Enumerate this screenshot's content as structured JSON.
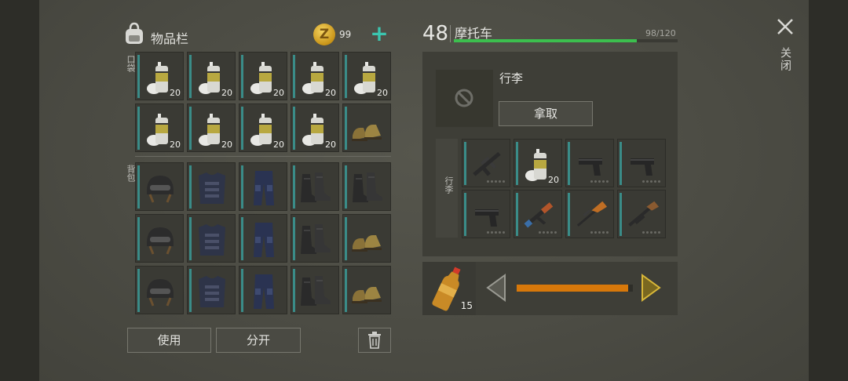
{
  "inventory": {
    "title": "物品栏",
    "coins": "99",
    "pocket_label": "口袋",
    "backpack_label": "背包",
    "pocket_slots": [
      {
        "item": "spray-paint",
        "qty": "20"
      },
      {
        "item": "spray-paint",
        "qty": "20"
      },
      {
        "item": "spray-paint",
        "qty": "20"
      },
      {
        "item": "spray-paint",
        "qty": "20"
      },
      {
        "item": "spray-paint",
        "qty": "20"
      },
      {
        "item": "spray-paint",
        "qty": "20"
      },
      {
        "item": "spray-paint",
        "qty": "20"
      },
      {
        "item": "spray-paint",
        "qty": "20"
      },
      {
        "item": "spray-paint",
        "qty": "20"
      },
      {
        "item": "brown-boots",
        "qty": ""
      }
    ],
    "backpack_slots": [
      {
        "item": "tactical-helmet"
      },
      {
        "item": "body-armor"
      },
      {
        "item": "armored-pants"
      },
      {
        "item": "black-boots"
      },
      {
        "item": "black-boots"
      },
      {
        "item": "tactical-helmet"
      },
      {
        "item": "body-armor"
      },
      {
        "item": "armored-pants"
      },
      {
        "item": "black-boots"
      },
      {
        "item": "brown-boots"
      },
      {
        "item": "tactical-helmet"
      },
      {
        "item": "body-armor"
      },
      {
        "item": "armored-pants"
      },
      {
        "item": "black-boots"
      },
      {
        "item": "brown-boots"
      }
    ],
    "use_label": "使用",
    "split_label": "分开"
  },
  "vehicle": {
    "level": "48",
    "name": "摩托车",
    "capacity": "98/120",
    "capacity_fraction": 0.8167,
    "luggage_title": "行李",
    "take_label": "拿取",
    "luggage_label": "行李",
    "slots": [
      {
        "item": "assault-rifle",
        "qty": ""
      },
      {
        "item": "spray-paint",
        "qty": "20"
      },
      {
        "item": "pistol",
        "qty": ""
      },
      {
        "item": "pistol",
        "qty": ""
      },
      {
        "item": "pistol",
        "qty": ""
      },
      {
        "item": "ak-rifle",
        "qty": ""
      },
      {
        "item": "hunting-rifle",
        "qty": ""
      },
      {
        "item": "shotgun",
        "qty": ""
      }
    ]
  },
  "quantity": {
    "value": "15",
    "fraction": 0.96
  },
  "close_label": "关闭",
  "colors": {
    "accent": "#3bc6b0",
    "capacity_bar": "#3cbf4e",
    "quantity_bar": "#d7780a",
    "gold": "#d9a838"
  }
}
